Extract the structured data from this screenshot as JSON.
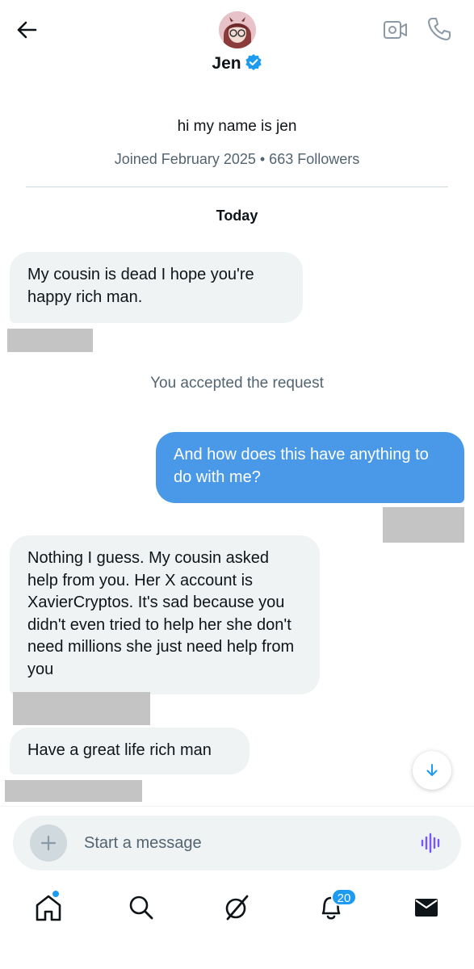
{
  "header": {
    "title": "Jen",
    "verified": true,
    "icons": [
      "back-arrow-icon",
      "video-call-icon",
      "phone-call-icon",
      "verified-badge-icon"
    ]
  },
  "profile": {
    "bio": "hi my name is jen",
    "meta": "Joined February 2025 • 663 Followers"
  },
  "conversation": {
    "day_label": "Today",
    "system_message": "You accepted the request",
    "messages": [
      {
        "direction": "incoming",
        "text": "My cousin is dead I hope you're happy rich man."
      },
      {
        "direction": "outgoing",
        "text": "And how does this have anything to do with me?"
      },
      {
        "direction": "incoming",
        "text": "Nothing I guess. My cousin asked help from you. Her X account is XavierCryptos. It's sad because you didn't even tried to help her she don't need millions she just need help from you"
      },
      {
        "direction": "incoming",
        "text": "Have a great life rich man"
      }
    ]
  },
  "composer": {
    "placeholder": "Start a message"
  },
  "tabbar": {
    "items": [
      "home-icon",
      "search-icon",
      "grok-icon",
      "notifications-icon",
      "messages-icon"
    ],
    "notification_count": "20"
  },
  "colors": {
    "accent": "#1d9bf0",
    "outgoing_bubble": "#4a99e9",
    "incoming_bubble": "#eff3f4",
    "secondary_text": "#536471",
    "voice_icon": "#7856ff"
  }
}
